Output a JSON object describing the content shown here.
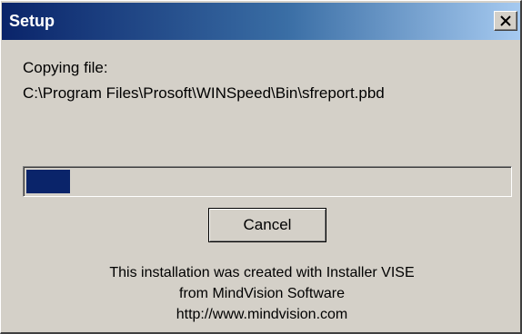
{
  "window": {
    "title": "Setup",
    "close_icon": "close-x-icon"
  },
  "status": {
    "action_label": "Copying file:",
    "file_path": "C:\\Program Files\\Prosoft\\WINSpeed\\Bin\\sfreport.pbd"
  },
  "progress": {
    "fraction": 0.09,
    "fill_color": "#0a246a"
  },
  "buttons": {
    "cancel_label": "Cancel"
  },
  "footer": {
    "line1": "This installation was created with Installer VISE",
    "line2": "from MindVision Software",
    "line3": "http://www.mindvision.com"
  },
  "colors": {
    "title_bar_start": "#0a246a",
    "title_bar_end": "#a6caf0",
    "dialog_background": "#d4d0c8"
  }
}
